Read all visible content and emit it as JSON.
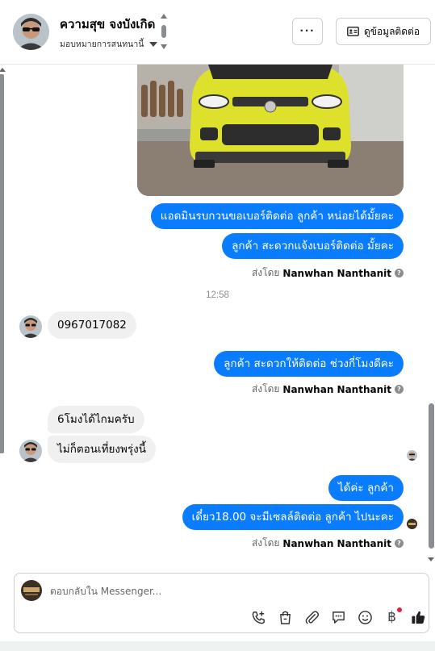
{
  "header": {
    "contact_name": "ความสุข จงบังเกิด",
    "assign_label": "มอบหมายการสนทนานี้",
    "more_label": "···",
    "contact_info_label": "ดูข้อมูลติดต่อ"
  },
  "messages": [
    {
      "dir": "out",
      "text": "แอดมินรบกวนขอเบอร์ติดต่อ ลูกค้า หน่อยได้มั้ยคะ"
    },
    {
      "dir": "out",
      "text": "ลูกค้า สะดวกแจ้งเบอร์ติดต่อ มั้ยคะ"
    },
    {
      "dir": "in",
      "text": "0967017082"
    },
    {
      "dir": "out",
      "text": "ลูกค้า สะดวกให้ติดต่อ ช่วงกี่โมงดีคะ"
    },
    {
      "dir": "in",
      "text": "6โมงได้ไกมครับ"
    },
    {
      "dir": "in",
      "text": "ไม่ก็ตอนเที่ยงพรุ่งนี้"
    },
    {
      "dir": "out",
      "text": "ได้ค่ะ  ลูกค้า"
    },
    {
      "dir": "out",
      "text": "เดี๋ยว18.00 จะมีเซลล์ติดต่อ ลูกค้า ไปนะคะ"
    }
  ],
  "sent_by": {
    "prefix": "ส่งโดย",
    "name": "Nanwhan Nanthanit",
    "info": "?"
  },
  "timestamp": "12:58",
  "composer": {
    "placeholder": "ตอบกลับใน Messenger..."
  },
  "toolbar_icons": [
    "phone-plus-icon",
    "shopping-bag-icon",
    "paperclip-icon",
    "saved-reply-icon",
    "emoji-icon",
    "baht-icon",
    "thumbs-up-icon"
  ],
  "toolbar_baht": "฿",
  "colors": {
    "outgoing_bubble": "#0a7cff",
    "incoming_bubble": "#f0f0f0",
    "accent_like": "#050505"
  }
}
